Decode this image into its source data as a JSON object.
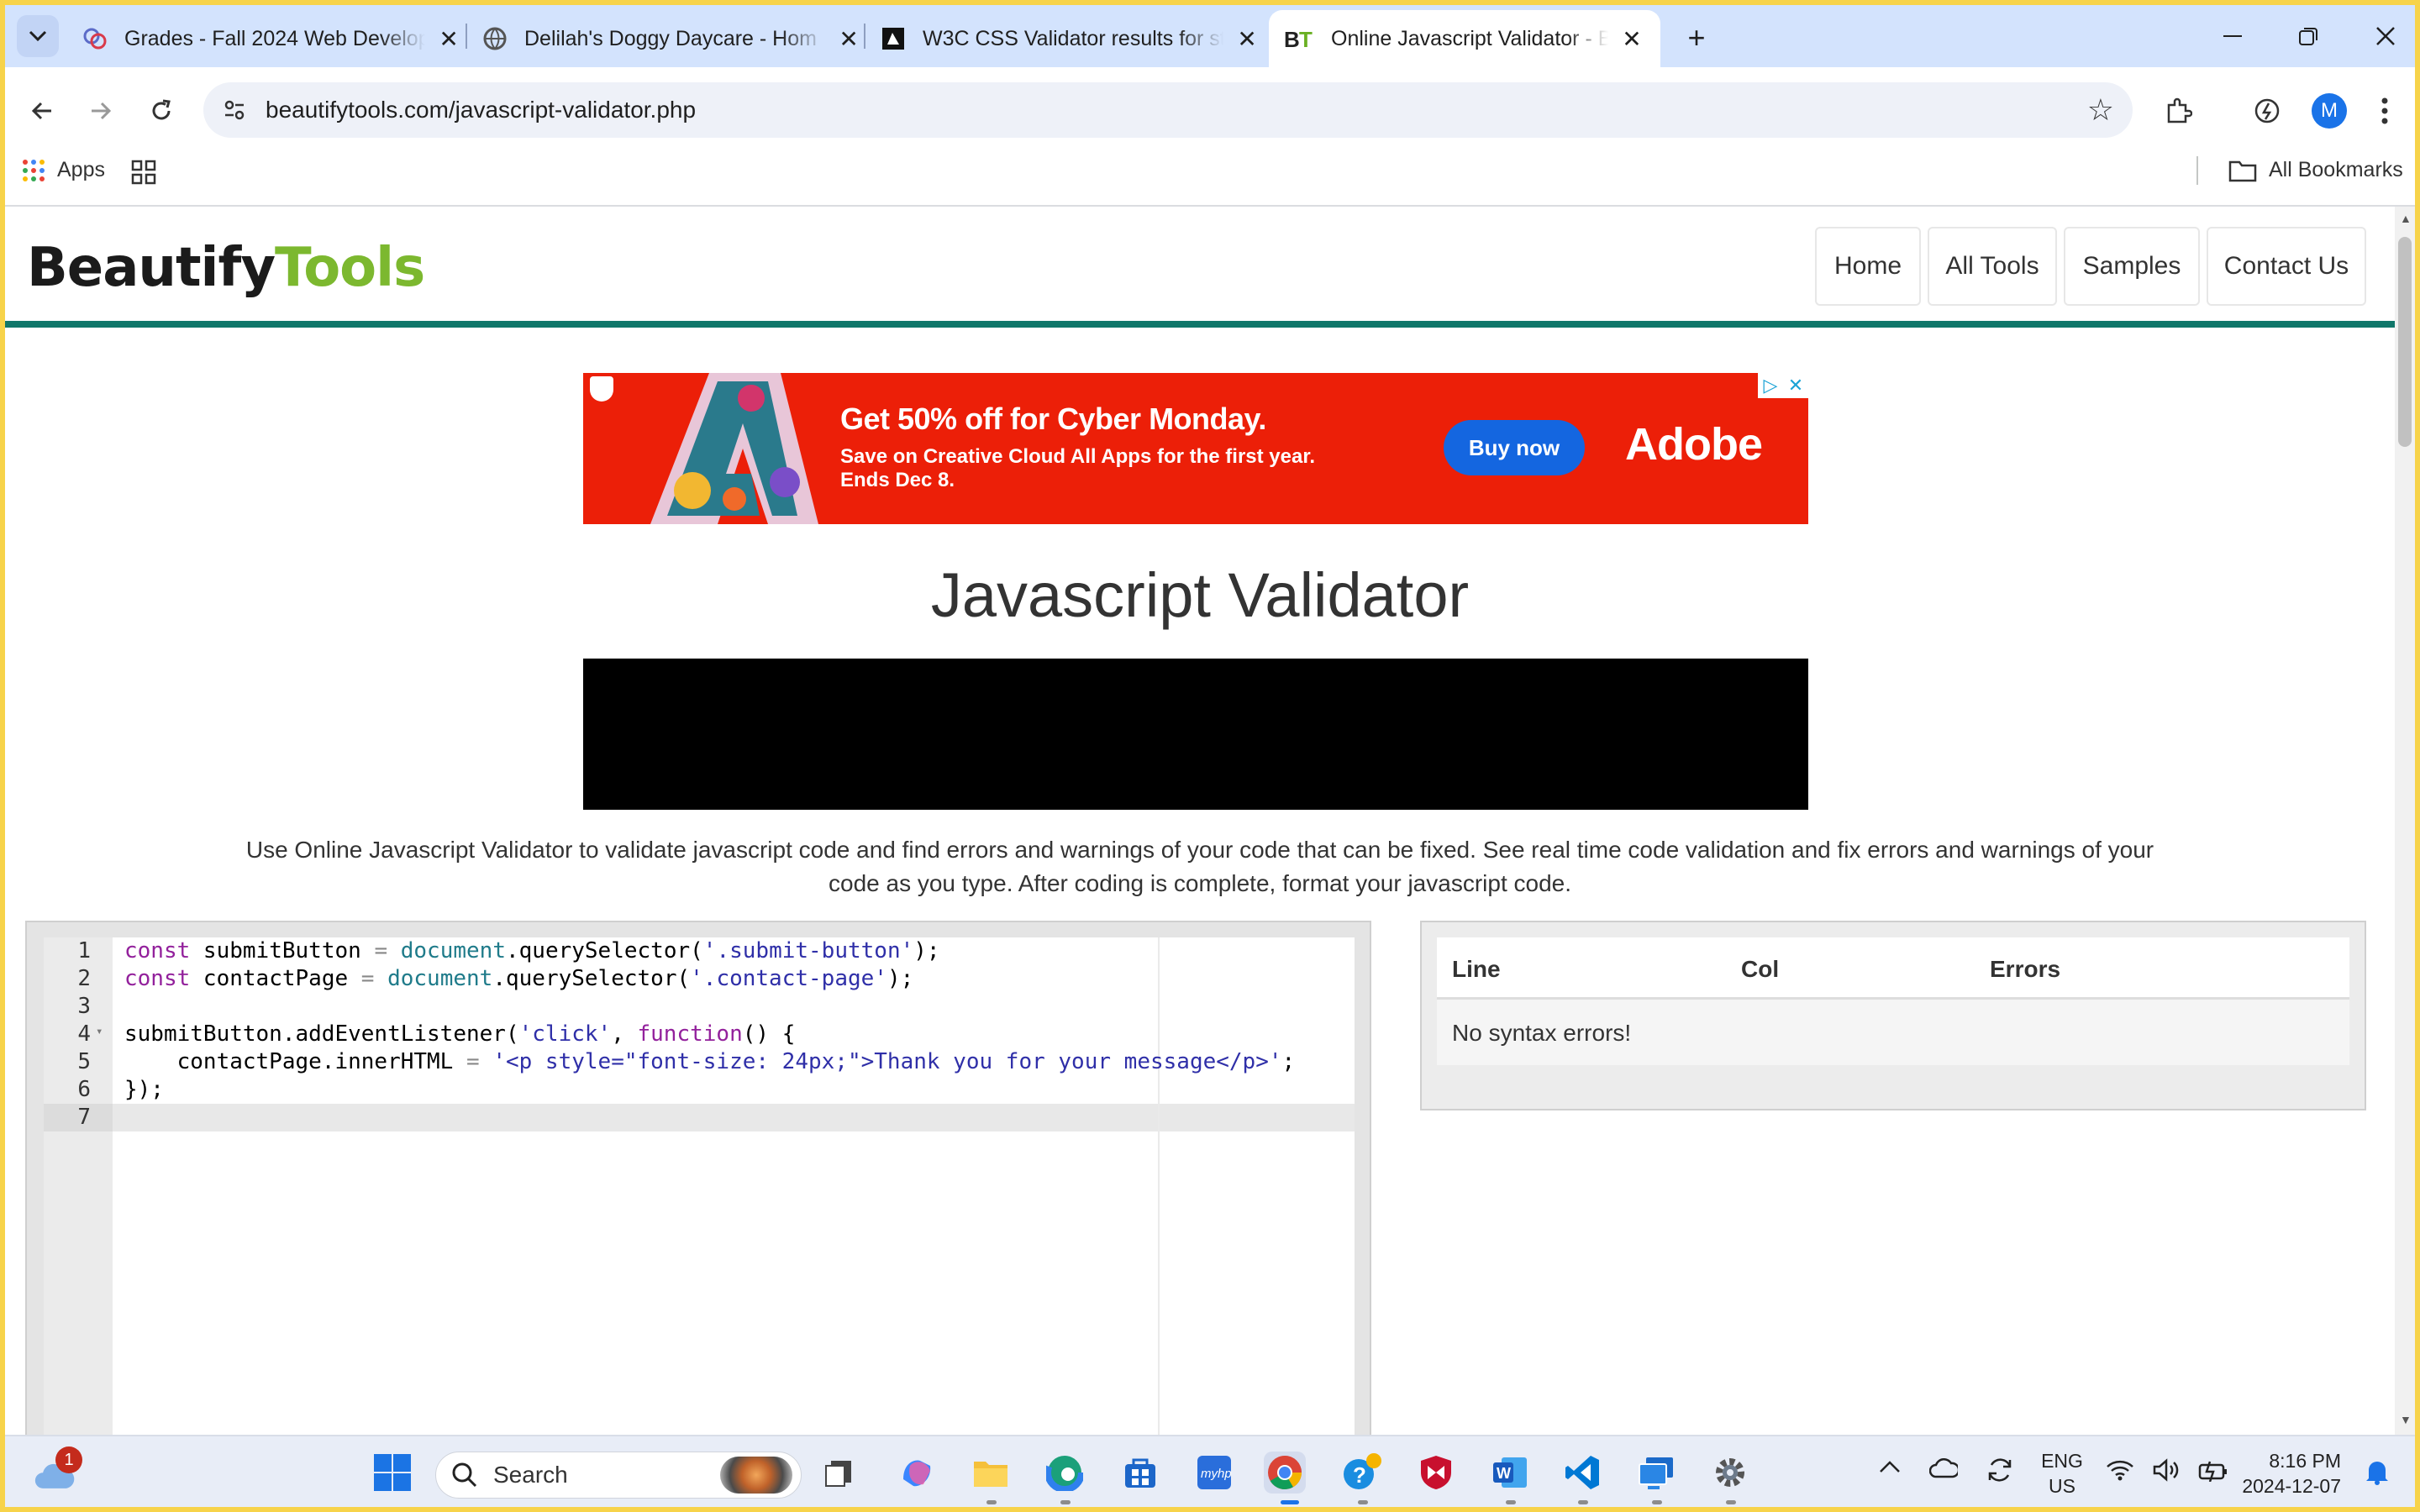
{
  "browser": {
    "tabs": [
      {
        "title": "Grades - Fall 2024 Web Develop",
        "active": false
      },
      {
        "title": "Delilah's Doggy Daycare - Hom",
        "active": false
      },
      {
        "title": "W3C CSS Validator results for st",
        "active": false
      },
      {
        "title": "Online Javascript Validator - Be",
        "active": true
      }
    ],
    "url": "beautifytools.com/javascript-validator.php",
    "bookmarks": {
      "apps": "Apps",
      "all_bookmarks": "All Bookmarks"
    },
    "profile_initial": "M"
  },
  "site": {
    "logo_part1": "Beautify",
    "logo_part2": "Tools",
    "nav": [
      "Home",
      "All Tools",
      "Samples",
      "Contact Us"
    ]
  },
  "ad": {
    "headline": "Get 50% off for Cyber Monday.",
    "subline1": "Save on Creative Cloud All Apps for the first year.",
    "subline2": "Ends Dec 8.",
    "cta": "Buy now",
    "brand": "Adobe"
  },
  "page": {
    "title": "Javascript Validator",
    "description": "Use Online Javascript Validator to validate javascript code and find errors and warnings of your code that can be fixed. See real time code validation and fix errors and warnings of your code as you type. After coding is complete, format your javascript code."
  },
  "editor": {
    "line_numbers": [
      "1",
      "2",
      "3",
      "4",
      "5",
      "6",
      "7"
    ],
    "lines": [
      "const submitButton = document.querySelector('.submit-button');",
      "const contactPage = document.querySelector('.contact-page');",
      "",
      "submitButton.addEventListener('click', function() {",
      "    contactPage.innerHTML = '<p style=\"font-size: 24px;\">Thank you for your message</p>';",
      "});",
      ""
    ]
  },
  "results": {
    "headers": [
      "Line",
      "Col",
      "Errors"
    ],
    "message": "No syntax errors!"
  },
  "taskbar": {
    "search_placeholder": "Search",
    "notification_count": "1",
    "lang_line1": "ENG",
    "lang_line2": "US",
    "time": "8:16 PM",
    "date": "2024-12-07"
  }
}
